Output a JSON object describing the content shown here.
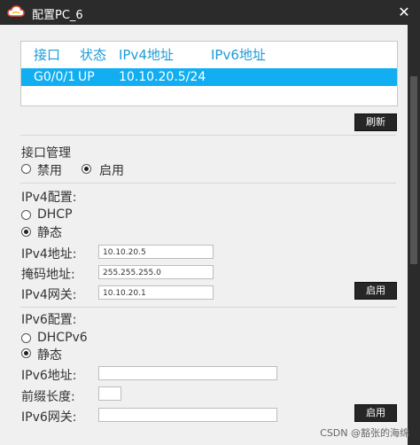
{
  "window": {
    "title": "配置PC_6",
    "close_icon": "close-icon"
  },
  "table": {
    "headers": [
      "接口",
      "状态",
      "IPv4地址",
      "IPv6地址"
    ],
    "rows": [
      {
        "port": "G0/0/1",
        "status": "UP",
        "ipv4": "10.10.20.5/24",
        "ipv6": ""
      }
    ],
    "refresh_label": "刷新"
  },
  "iface_mgmt": {
    "title": "接口管理",
    "disable_label": "禁用",
    "enable_label": "启用",
    "selected": "启用"
  },
  "ipv4": {
    "title": "IPv4配置:",
    "dhcp_label": "DHCP",
    "static_label": "静态",
    "selected": "静态",
    "addr_label": "IPv4地址:",
    "addr_value": "10.10.20.5",
    "mask_label": "掩码地址:",
    "mask_value": "255.255.255.0",
    "gw_label": "IPv4网关:",
    "gw_value": "10.10.20.1",
    "apply_label": "启用"
  },
  "ipv6": {
    "title": "IPv6配置:",
    "dhcp_label": "DHCPv6",
    "static_label": "静态",
    "selected": "静态",
    "addr_label": "IPv6地址:",
    "addr_value": "",
    "prefix_label": "前缀长度:",
    "prefix_value": "",
    "gw_label": "IPv6网关:",
    "gw_value": "",
    "apply_label": "启用"
  },
  "watermark": "CSDN @豁张的海绵"
}
